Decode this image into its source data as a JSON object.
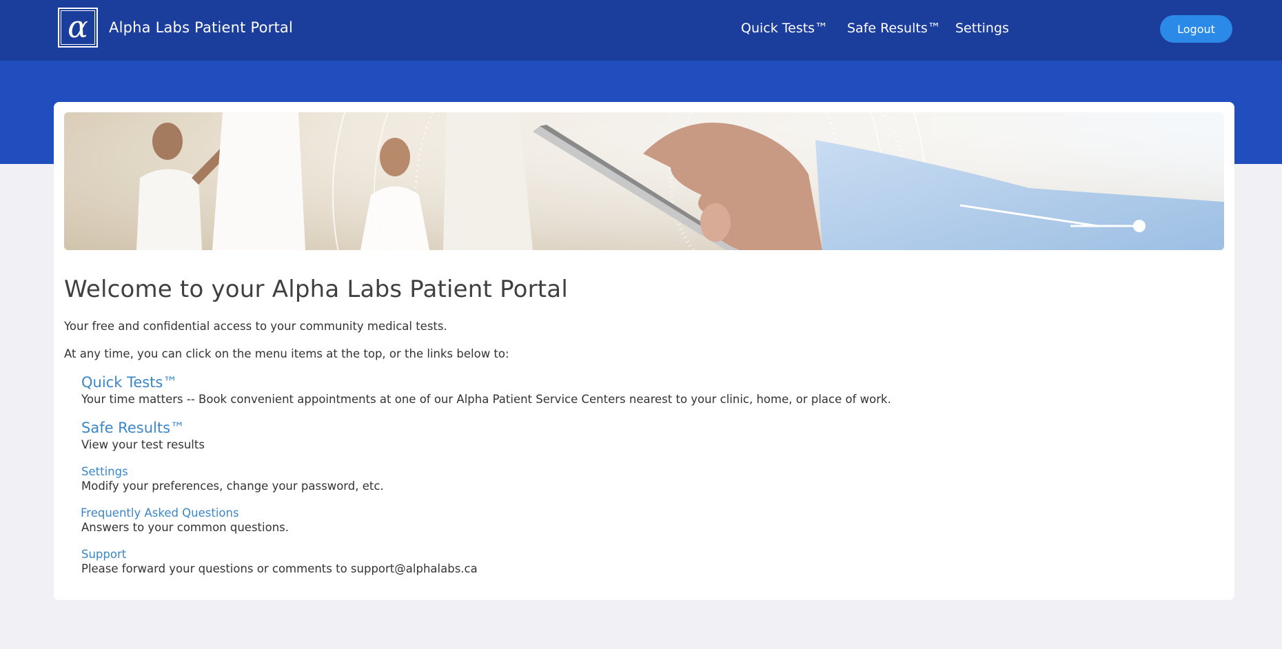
{
  "header": {
    "logo_glyph": "α",
    "title": "Alpha Labs Patient Portal",
    "nav": {
      "quick_tests": "Quick Tests™",
      "safe_results": "Safe Results™",
      "settings": "Settings"
    },
    "logout": "Logout"
  },
  "main": {
    "heading": "Welcome to your Alpha Labs Patient Portal",
    "intro": "Your free and confidential access to your community medical tests.",
    "instructions": "At any time, you can click on the menu items at the top, or the links below to:",
    "links": [
      {
        "title": "Quick Tests™",
        "desc": "Your time matters -- Book convenient appointments at one of our Alpha Patient Service Centers nearest to your clinic, home, or place of work."
      },
      {
        "title": "Safe Results™",
        "desc": "View your test results"
      },
      {
        "title": "Settings",
        "desc": "Modify your preferences, change your password, etc."
      },
      {
        "title": "Frequently Asked Questions",
        "desc": "Answers to your common questions."
      },
      {
        "title": "Support",
        "desc": "Please forward your questions or comments to support@alphalabs.ca"
      }
    ]
  },
  "colors": {
    "topbar": "#1b3d9c",
    "band": "#214ebe",
    "button": "#2b8ae8",
    "link": "#3a86c8"
  }
}
